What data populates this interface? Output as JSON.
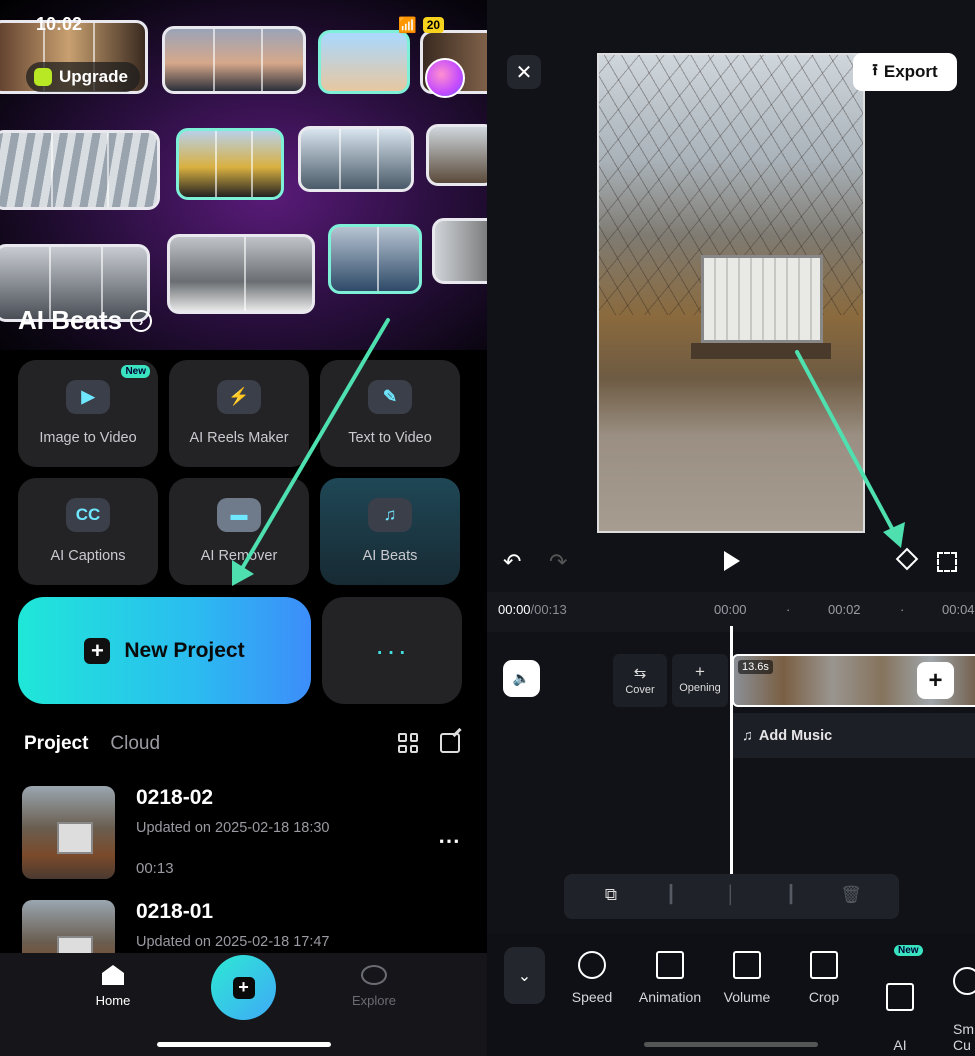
{
  "left": {
    "status": {
      "time": "10:02",
      "battery": "20"
    },
    "upgrade_label": "Upgrade",
    "hero_title": "AI Beats",
    "tools": [
      {
        "label": "Image to Video",
        "icon": "image-to-video-icon",
        "badge": "New"
      },
      {
        "label": "AI Reels Maker",
        "icon": "bolt-icon"
      },
      {
        "label": "Text  to Video",
        "icon": "pen-icon"
      },
      {
        "label": "AI Captions",
        "icon": "cc-icon",
        "glyph": "CC"
      },
      {
        "label": "AI Remover",
        "icon": "eraser-icon"
      },
      {
        "label": "AI Beats",
        "icon": "beats-icon"
      }
    ],
    "new_project_label": "New Project",
    "more_label": "···",
    "tabs": {
      "project": "Project",
      "cloud": "Cloud"
    },
    "projects": [
      {
        "name": "0218-02",
        "updated": "Updated on 2025-02-18 18:30",
        "duration": "00:13"
      },
      {
        "name": "0218-01",
        "updated": "Updated on 2025-02-18 17:47"
      }
    ],
    "nav": {
      "home": "Home",
      "explore": "Explore"
    }
  },
  "right": {
    "close_glyph": "✕",
    "export_label": "Export",
    "timecode": {
      "current": "00:00",
      "total": "/00:13"
    },
    "ruler_ticks": [
      "00:00",
      "·",
      "00:02",
      "·",
      "00:04"
    ],
    "cover_label": "Cover",
    "opening_label": "Opening",
    "clip_duration": "13.6s",
    "add_music_label": "Add Music",
    "tools": [
      {
        "label": "Speed",
        "icon": "speed-icon"
      },
      {
        "label": "Animation",
        "icon": "animation-icon"
      },
      {
        "label": "Volume",
        "icon": "volume-icon"
      },
      {
        "label": "Crop",
        "icon": "crop-icon"
      },
      {
        "label": "AI\nRemover",
        "icon": "ai-remover-icon",
        "badge": "New"
      },
      {
        "label": "Sm\nCu",
        "icon": "smart-cutout-icon"
      }
    ]
  },
  "colors": {
    "accent_teal": "#39e3c0",
    "new_project_gradient_start": "#1fe7d8",
    "new_project_gradient_end": "#3d8dfa",
    "annotation_arrow": "#4fe0b0"
  }
}
